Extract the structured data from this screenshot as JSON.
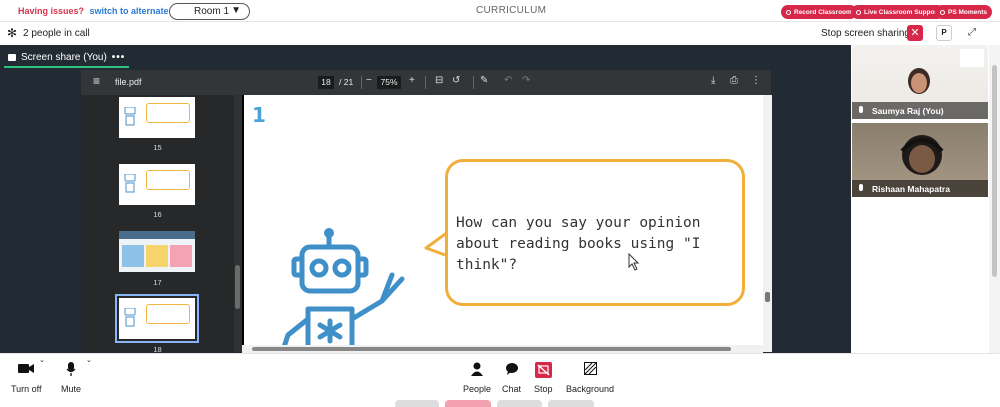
{
  "topbar": {
    "issues_text": "Having issues?",
    "issues_link": "switch to alternate room",
    "room_selected": "Room 1",
    "title": "CURRICULUM",
    "buttons": [
      "Record Classroom",
      "Live Classroom Support",
      "PS Moments"
    ],
    "brand_color": "#d8284a"
  },
  "callbar": {
    "people_count": "2 people in call",
    "stop_sharing": "Stop screen sharing",
    "close": "✕",
    "p_button": "P"
  },
  "share_tab": {
    "label": "Screen share (You)",
    "more": "•••"
  },
  "pdf": {
    "file_name": "file.pdf",
    "current_page": "18",
    "total_pages": "/ 21",
    "zoom": "75%",
    "thumbnails": [
      {
        "num": "15"
      },
      {
        "num": "16"
      },
      {
        "num": "17"
      },
      {
        "num": "18",
        "selected": true
      }
    ],
    "page_number_label": "1",
    "speech_text": "How can you say your opinion about reading books using \"I think\"?"
  },
  "videos": [
    {
      "name": "Saumya Raj (You)"
    },
    {
      "name": "Rishaan Mahapatra"
    }
  ],
  "bottombar": {
    "turn_off": "Turn off",
    "mute": "Mute",
    "people": "People",
    "chat": "Chat",
    "stop": "Stop",
    "background": "Background"
  }
}
